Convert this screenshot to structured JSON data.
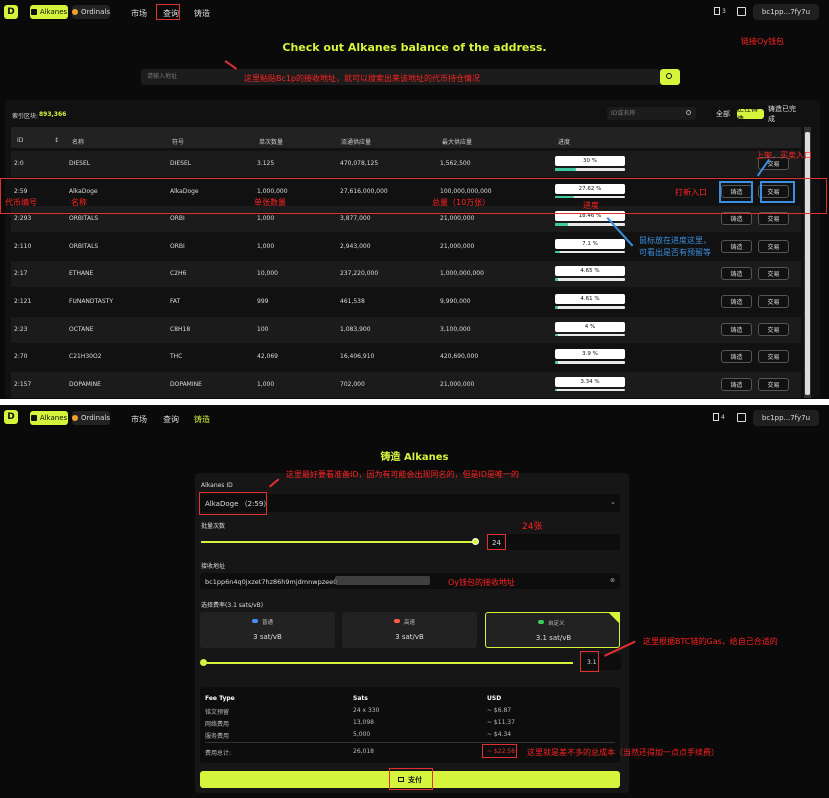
{
  "top": {
    "nav": {
      "tab_alkanes": "Alkanes",
      "tab_ordinals": "Ordinals",
      "link_market": "市场",
      "link_query": "查询",
      "link_mint": "铸造",
      "fuel_count": "3",
      "wallet": "bc1pp...7fy7u"
    },
    "headline": "Check out Alkanes balance of the address.",
    "search_placeholder": "请输入地址",
    "index_label": "索引区块:",
    "index_value": "893,366",
    "filter_placeholder": "ID或名称",
    "filters": [
      "全部",
      "正在铸造",
      "铸造已完成"
    ],
    "columns": [
      "ID",
      "名称",
      "符号",
      "单次数量",
      "流通供应量",
      "最大供应量",
      "进度"
    ],
    "rows": [
      {
        "id": "2:0",
        "name": "DIESEL",
        "symbol": "DIESEL",
        "per_mint": "3.125",
        "circulating": "470,078,125",
        "max": "1,562,500",
        "progress": "30 %",
        "pct": 30,
        "mint": false
      },
      {
        "id": "2:59",
        "name": "AlkaDoge",
        "symbol": "AlkaDoge",
        "per_mint": "1,000,000",
        "circulating": "27,616,000,000",
        "max": "100,000,000,000",
        "progress": "27.62 %",
        "pct": 27.62,
        "mint": true
      },
      {
        "id": "2:293",
        "name": "ORBITALS",
        "symbol": "ORBI",
        "per_mint": "1,000",
        "circulating": "3,877,000",
        "max": "21,000,000",
        "progress": "18.46 %",
        "pct": 18.46,
        "mint": true
      },
      {
        "id": "2:110",
        "name": "ORBITALS",
        "symbol": "ORBI",
        "per_mint": "1,000",
        "circulating": "2,943,000",
        "max": "21,000,000",
        "progress": "7.1 %",
        "pct": 7.1,
        "mint": true
      },
      {
        "id": "2:17",
        "name": "ETHANE",
        "symbol": "C2H6",
        "per_mint": "10,000",
        "circulating": "237,220,000",
        "max": "1,000,000,000",
        "progress": "4.65 %",
        "pct": 4.65,
        "mint": true
      },
      {
        "id": "2:121",
        "name": "FUNANDTASTY",
        "symbol": "FAT",
        "per_mint": "999",
        "circulating": "461,538",
        "max": "9,990,000",
        "progress": "4.61 %",
        "pct": 4.61,
        "mint": true
      },
      {
        "id": "2:23",
        "name": "OCTANE",
        "symbol": "C8H18",
        "per_mint": "100",
        "circulating": "1,083,900",
        "max": "3,100,000",
        "progress": "4 %",
        "pct": 4,
        "mint": true
      },
      {
        "id": "2:70",
        "name": "C21H30O2",
        "symbol": "THC",
        "per_mint": "42,069",
        "circulating": "16,406,910",
        "max": "420,690,000",
        "progress": "3.9 %",
        "pct": 3.9,
        "mint": true
      },
      {
        "id": "2:157",
        "name": "DOPAMINE",
        "symbol": "DOPAMINE",
        "per_mint": "1,000",
        "circulating": "702,000",
        "max": "21,000,000",
        "progress": "3.34 %",
        "pct": 3.34,
        "mint": true
      }
    ],
    "mint_btn": "铸造",
    "trade_btn": "交易"
  },
  "top_annotations": {
    "wallet": "链接Oy钱包",
    "search": "这里粘贴Bc1p的接收地址，就可以搜索出来该地址的代币持仓情况",
    "list": "上架，买卖入口",
    "mint": "打新入口",
    "id": "代币编号",
    "name": "名称",
    "per": "单张数量",
    "total": "总量（10万张）",
    "progress": "进度",
    "hover": "鼠标放在进度这里，\n可看出是否有预留等"
  },
  "bottom": {
    "nav": {
      "tab_alkanes": "Alkanes",
      "tab_ordinals": "Ordinals",
      "link_market": "市场",
      "link_query": "查询",
      "link_mint": "铸造",
      "fuel_count": "4",
      "wallet": "bc1pp...7fy7u"
    },
    "title": "铸造 Alkanes",
    "id_label": "Alkanes ID",
    "id_value": "AlkaDoge （2:59）",
    "batch_label": "批量次数",
    "batch_value": "24",
    "recv_label": "接收地址",
    "recv_value": "bc1pp6n4q0jxzet7hz86h9mjdmnwpzee0",
    "fee_label": "选择费率(3.1 sats/vB)",
    "fee_opts": [
      {
        "name": "普通",
        "rate": "3 sat/vB",
        "color": "#4a8cff"
      },
      {
        "name": "高速",
        "rate": "3 sat/vB",
        "color": "#ff5a4a"
      },
      {
        "name": "自定义",
        "rate": "3.1 sat/vB",
        "color": "#3ec95a"
      }
    ],
    "custom_rate": "3.1",
    "fee_headers": [
      "Fee Type",
      "Sats",
      "USD"
    ],
    "fees": [
      {
        "type": "铭文预留",
        "sats": "24 x 330",
        "usd": "~ $6.87"
      },
      {
        "type": "网络费用",
        "sats": "13,098",
        "usd": "~ $11.37"
      },
      {
        "type": "服务费用",
        "sats": "5,000",
        "usd": "~ $4.34"
      }
    ],
    "total": {
      "type": "费用总计:",
      "sats": "26,018",
      "usd": "~ $22.58"
    },
    "pay": "支付"
  },
  "bottom_annotations": {
    "id": "这里最好要看准备ID，因为有可能会出现同名的，但是ID是唯一的",
    "count": "24张",
    "addr": "Oy钱包的接收地址",
    "gas": "这里根据BTC链的Gas，给自己合适的",
    "cost": "这里就是差不多的总成本（当然还得加一点点手续费）"
  },
  "colors": {
    "accent": "#d4f53c",
    "annot": "#ff2222",
    "blue": "#3a8fe0",
    "progress": "#3ec9a0"
  }
}
